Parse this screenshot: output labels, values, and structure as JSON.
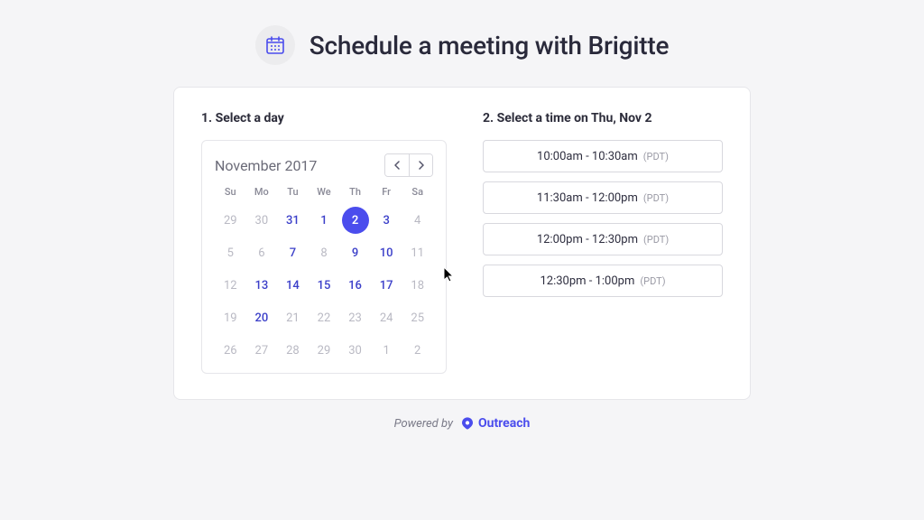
{
  "header": {
    "title": "Schedule a meeting with Brigitte"
  },
  "step1": {
    "title": "1. Select a day",
    "month_label": "November 2017",
    "dow": [
      "Su",
      "Mo",
      "Tu",
      "We",
      "Th",
      "Fr",
      "Sa"
    ],
    "days": [
      {
        "n": "29",
        "state": "dim"
      },
      {
        "n": "30",
        "state": "dim"
      },
      {
        "n": "31",
        "state": "avail"
      },
      {
        "n": "1",
        "state": "avail"
      },
      {
        "n": "2",
        "state": "selected"
      },
      {
        "n": "3",
        "state": "avail"
      },
      {
        "n": "4",
        "state": "dim"
      },
      {
        "n": "5",
        "state": "dim"
      },
      {
        "n": "6",
        "state": "dim"
      },
      {
        "n": "7",
        "state": "avail"
      },
      {
        "n": "8",
        "state": "dim"
      },
      {
        "n": "9",
        "state": "avail"
      },
      {
        "n": "10",
        "state": "avail"
      },
      {
        "n": "11",
        "state": "dim"
      },
      {
        "n": "12",
        "state": "dim"
      },
      {
        "n": "13",
        "state": "avail"
      },
      {
        "n": "14",
        "state": "avail"
      },
      {
        "n": "15",
        "state": "avail"
      },
      {
        "n": "16",
        "state": "avail"
      },
      {
        "n": "17",
        "state": "avail"
      },
      {
        "n": "18",
        "state": "dim"
      },
      {
        "n": "19",
        "state": "dim"
      },
      {
        "n": "20",
        "state": "avail"
      },
      {
        "n": "21",
        "state": "dim"
      },
      {
        "n": "22",
        "state": "dim"
      },
      {
        "n": "23",
        "state": "dim"
      },
      {
        "n": "24",
        "state": "dim"
      },
      {
        "n": "25",
        "state": "dim"
      },
      {
        "n": "26",
        "state": "dim"
      },
      {
        "n": "27",
        "state": "dim"
      },
      {
        "n": "28",
        "state": "dim"
      },
      {
        "n": "29",
        "state": "dim"
      },
      {
        "n": "30",
        "state": "dim"
      },
      {
        "n": "1",
        "state": "dim"
      },
      {
        "n": "2",
        "state": "dim"
      }
    ]
  },
  "step2": {
    "title": "2. Select a time on Thu, Nov 2",
    "tz": "(PDT)",
    "slots": [
      "10:00am - 10:30am",
      "11:30am - 12:00pm",
      "12:00pm - 12:30pm",
      "12:30pm - 1:00pm"
    ]
  },
  "footer": {
    "powered_by": "Powered by",
    "brand": "Outreach"
  }
}
